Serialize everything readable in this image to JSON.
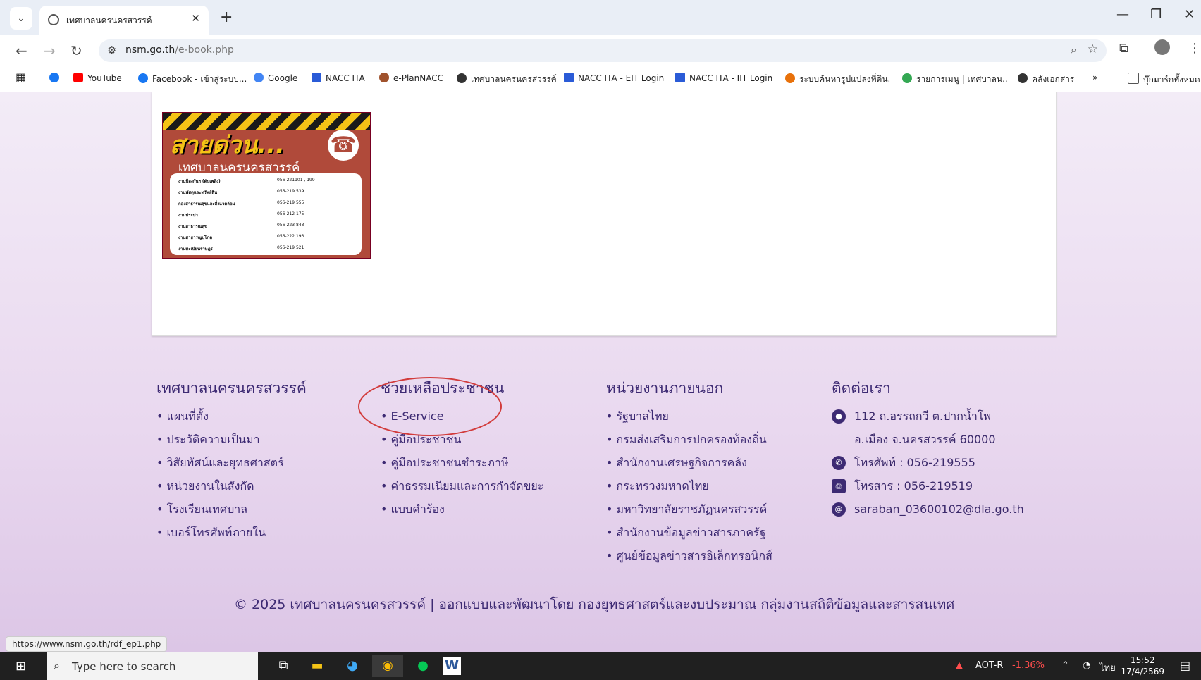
{
  "browser": {
    "tab_title": "เทศบาลนครนครสวรรค์",
    "url_host": "nsm.go.th",
    "url_path": "/e-book.php",
    "bookmarks": [
      {
        "label": "YouTube",
        "color": "#ff0000"
      },
      {
        "label": "Facebook - เข้าสู่ระบบ...",
        "color": "#1877f2"
      },
      {
        "label": "Google",
        "color": "#4285f4"
      },
      {
        "label": "NACC ITA",
        "color": "#2a5bd7"
      },
      {
        "label": "e-PlanNACC",
        "color": "#a0522d"
      },
      {
        "label": "เทศบาลนครนครสวรรค์",
        "color": "#333333"
      },
      {
        "label": "NACC ITA - EIT Login",
        "color": "#2a5bd7"
      },
      {
        "label": "NACC ITA - IIT Login",
        "color": "#2a5bd7"
      },
      {
        "label": "ระบบค้นหารูปแปลงที่ดิน...",
        "color": "#e8710a"
      },
      {
        "label": "รายการเมนู | เทศบาลน...",
        "color": "#34a853"
      },
      {
        "label": "คลังเอกสาร",
        "color": "#333333"
      }
    ],
    "bookmarks_folder": "บุ๊กมาร์กทั้งหมด"
  },
  "hotline_banner": {
    "heading": "สายด่วน...",
    "subheading": "เทศบาลนครนครสวรรค์",
    "rows": [
      {
        "name": "งานป้องกันฯ (ดับเพลิง)",
        "number": "056-221101 , 199"
      },
      {
        "name": "งานพัสดุและทรัพย์สิน",
        "number": "056-219 539"
      },
      {
        "name": "กองสาธารณสุขและสิ่งแวดล้อม",
        "number": "056-219 555"
      },
      {
        "name": "งานประปา",
        "number": "056-212 175"
      },
      {
        "name": "งานสาธารณสุข",
        "number": "056-223 843"
      },
      {
        "name": "งานสาธารณูปโภค",
        "number": "056-222 193"
      },
      {
        "name": "งานทะเบียนราษฎร",
        "number": "056-219 521"
      }
    ]
  },
  "footer": {
    "col1": {
      "title": "เทศบาลนครนครสวรรค์",
      "items": [
        "แผนที่ตั้ง",
        "ประวัติความเป็นมา",
        "วิสัยทัศน์และยุทธศาสตร์",
        "หน่วยงานในสังกัด",
        "โรงเรียนเทศบาล",
        "เบอร์โทรศัพท์ภายใน"
      ]
    },
    "col2": {
      "title": "ช่วยเหลือประชาชน",
      "items": [
        "E-Service",
        "คู่มือประชาชน",
        "คู่มือประชาชนชำระภาษี",
        "ค่าธรรมเนียมและการกำจัดขยะ",
        "แบบคำร้อง"
      ]
    },
    "col3": {
      "title": "หน่วยงานภายนอก",
      "items": [
        "รัฐบาลไทย",
        "กรมส่งเสริมการปกครองท้องถิ่น",
        "สำนักงานเศรษฐกิจการคลัง",
        "กระทรวงมหาดไทย",
        "มหาวิทยาลัยราชภัฏนครสวรรค์",
        "สำนักงานข้อมูลข่าวสารภาครัฐ",
        "ศูนย์ข้อมูลข่าวสารอิเล็กทรอนิกส์"
      ]
    },
    "contact": {
      "title": "ติดต่อเรา",
      "address_line1": "112 ถ.อรรถกวี ต.ปากน้ำโพ",
      "address_line2": "อ.เมือง จ.นครสวรรค์ 60000",
      "phone": "โทรศัพท์ : 056-219555",
      "fax": "โทรสาร : 056-219519",
      "email": "saraban_03600102@dla.go.th"
    },
    "copyright": "© 2025 เทศบาลนครนครสวรรค์ | ออกแบบและพัฒนาโดย กองยุทธศาสตร์และงบประมาณ กลุ่มงานสถิติข้อมูลและสารสนเทศ"
  },
  "status_url": "https://www.nsm.go.th/rdf_ep1.php",
  "taskbar": {
    "search_placeholder": "Type here to search",
    "stock": "AOT-R",
    "stock_change": "-1.36%",
    "language": "ไทย",
    "time": "15:52",
    "date": "17/4/2569"
  }
}
